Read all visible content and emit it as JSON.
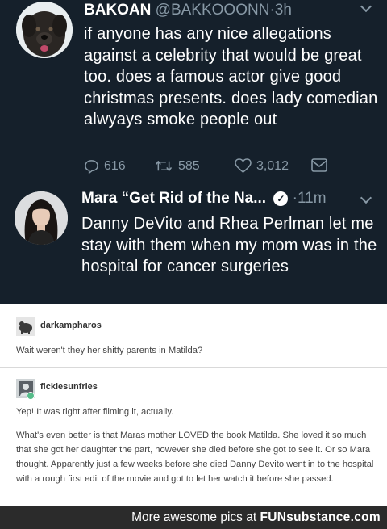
{
  "tweets": [
    {
      "name": "BAKOAN",
      "handle": "@BAKKOOONN",
      "sep": "·",
      "time": "3h",
      "text": "if anyone has any nice allegations against a celebrity that would be great too. does a famous actor give good christmas presents. does lady comedian alwyays smoke people out",
      "replies": "616",
      "retweets": "585",
      "likes": "3,012"
    },
    {
      "name": "Mara “Get Rid of the Na...",
      "verified_glyph": "✓",
      "sep": "·",
      "time": "11m",
      "text": "Danny DeVito and Rhea Perlman let me stay with them when my mom was in the hospital for cancer surgeries"
    }
  ],
  "tumblr": [
    {
      "username": "darkampharos",
      "text": "Wait weren't they her shitty parents in Matilda?"
    },
    {
      "username": "ficklesunfries",
      "text1": "Yep! It was right after filming it, actually.",
      "text2": "What's even better is that Maras mother LOVED the book Matilda. She loved it so much that she got her daughter the part, however she died before she got to see it. Or so Mara thought. Apparently just a few weeks before she died Danny Devito went in to the hospital with a rough first edit of the movie and got to let her watch it before she passed."
    }
  ],
  "footer": {
    "lead": "More awesome pics at",
    "brand_a": "FUN",
    "brand_b": "substance",
    "brand_c": ".com"
  },
  "colors": {
    "twitter_bg": "#15202b",
    "twitter_muted": "#8899a6",
    "tumblr_bg": "#ffffff",
    "footer_bg": "#2b2b2b"
  }
}
